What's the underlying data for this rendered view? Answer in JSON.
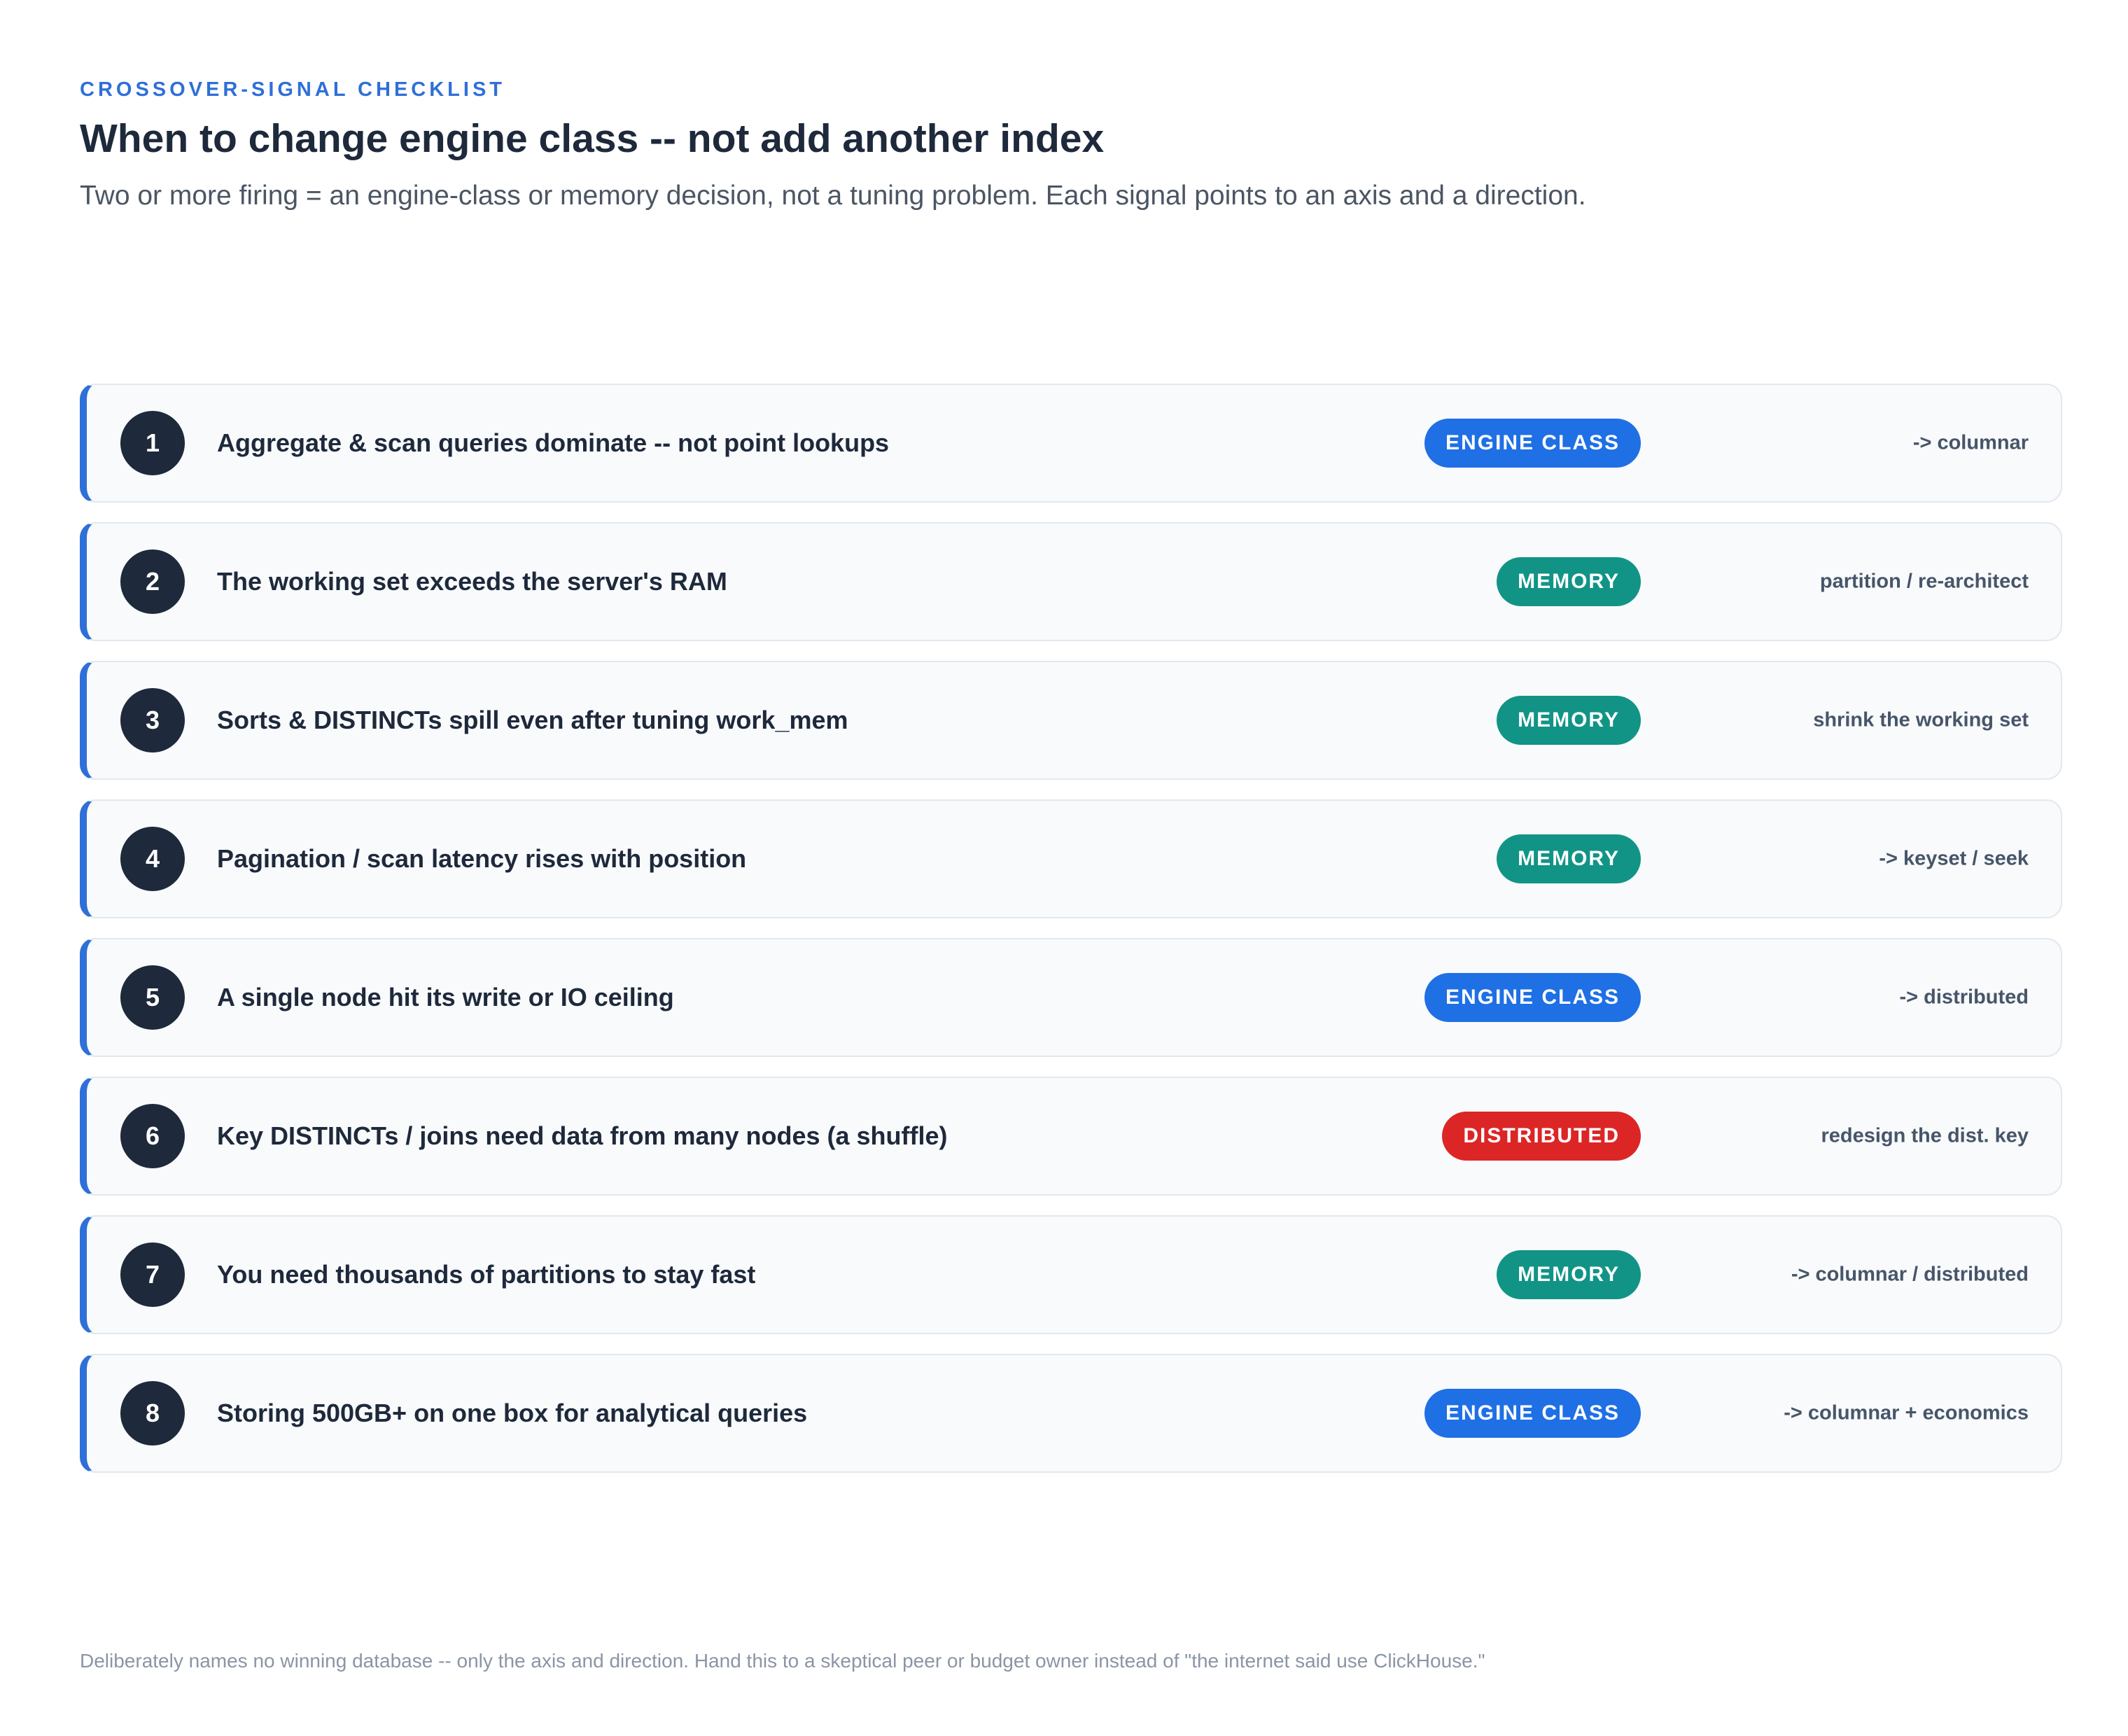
{
  "header": {
    "eyebrow": "CROSSOVER-SIGNAL CHECKLIST",
    "title": "When to change engine class -- not add another index",
    "subtitle": "Two or more firing = an engine-class or memory decision, not a tuning problem. Each signal points to an axis and a direction."
  },
  "colors": {
    "accent": "#2f6fd8",
    "engine_class": "#1f6fe5",
    "memory": "#119486",
    "distributed": "#dc2626",
    "number_badge": "#1e293b"
  },
  "signals": [
    {
      "number": "1",
      "text": "Aggregate & scan queries dominate -- not point lookups",
      "axis": "ENGINE CLASS",
      "axis_type": "engine",
      "direction": "-> columnar"
    },
    {
      "number": "2",
      "text": "The working set exceeds the server's RAM",
      "axis": "MEMORY",
      "axis_type": "memory",
      "direction": "partition / re-architect"
    },
    {
      "number": "3",
      "text": "Sorts & DISTINCTs spill even after tuning work_mem",
      "axis": "MEMORY",
      "axis_type": "memory",
      "direction": "shrink the working set"
    },
    {
      "number": "4",
      "text": "Pagination / scan latency rises with position",
      "axis": "MEMORY",
      "axis_type": "memory",
      "direction": "-> keyset / seek"
    },
    {
      "number": "5",
      "text": "A single node hit its write or IO ceiling",
      "axis": "ENGINE CLASS",
      "axis_type": "engine",
      "direction": "-> distributed"
    },
    {
      "number": "6",
      "text": "Key DISTINCTs / joins need data from many nodes (a shuffle)",
      "axis": "DISTRIBUTED",
      "axis_type": "distributed",
      "direction": "redesign the dist. key"
    },
    {
      "number": "7",
      "text": "You need thousands of partitions to stay fast",
      "axis": "MEMORY",
      "axis_type": "memory",
      "direction": "-> columnar / distributed"
    },
    {
      "number": "8",
      "text": "Storing 500GB+ on one box for analytical queries",
      "axis": "ENGINE CLASS",
      "axis_type": "engine",
      "direction": "-> columnar + economics"
    }
  ],
  "footnote": "Deliberately names no winning database -- only the axis and direction. Hand this to a skeptical peer or budget owner instead of \"the internet said use ClickHouse.\""
}
